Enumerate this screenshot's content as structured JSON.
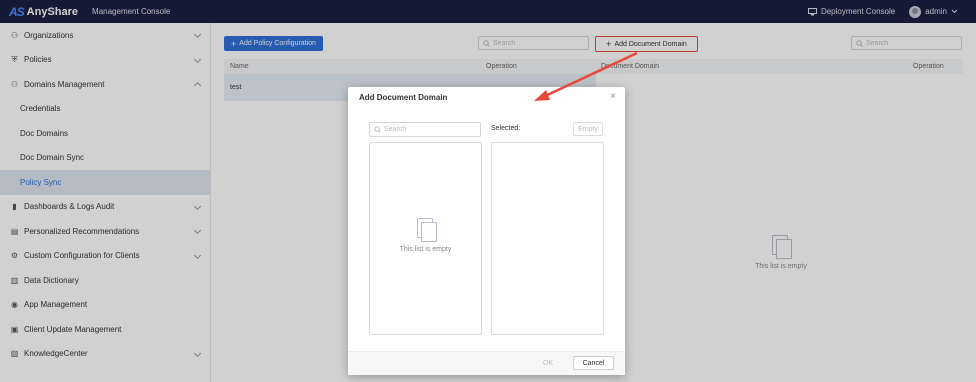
{
  "topbar": {
    "logo_mark": "AS",
    "logo_text": "AnyShare",
    "console_title": "Management Console",
    "deployment_console": "Deployment Console",
    "user": "admin"
  },
  "sidebar": {
    "items": [
      {
        "label": "Organizations",
        "icon": "org-icon",
        "expand": "down"
      },
      {
        "label": "Policies",
        "icon": "shield-icon",
        "expand": "down"
      },
      {
        "label": "Domains Management",
        "icon": "domain-icon",
        "expand": "up"
      },
      {
        "label": "Credentials",
        "sub": true
      },
      {
        "label": "Doc Domains",
        "sub": true
      },
      {
        "label": "Doc Domain Sync",
        "sub": true
      },
      {
        "label": "Policy Sync",
        "sub": true,
        "active": true
      },
      {
        "label": "Dashboards & Logs Audit",
        "icon": "bar-chart-icon",
        "expand": "down"
      },
      {
        "label": "Personalized Recommendations",
        "icon": "recommend-icon",
        "expand": "down"
      },
      {
        "label": "Custom Configuration for Clients",
        "icon": "gear-icon",
        "expand": "down"
      },
      {
        "label": "Data Dictionary",
        "icon": "book-icon"
      },
      {
        "label": "App Management",
        "icon": "app-icon"
      },
      {
        "label": "Client Update Management",
        "icon": "update-icon"
      },
      {
        "label": "KnowledgeCenter",
        "icon": "knowledge-icon",
        "expand": "down"
      }
    ]
  },
  "main": {
    "add_policy_button": "Add Policy Configuration",
    "left_search_placeholder": "Search",
    "add_domain_button": "Add Document Domain",
    "right_search_placeholder": "Search",
    "left_table": {
      "col_name": "Name",
      "col_operation": "Operation",
      "rows": [
        "test"
      ]
    },
    "right_table": {
      "col_domain": "Document Domain",
      "col_operation": "Operation"
    },
    "right_empty": "This list is empty"
  },
  "dialog": {
    "title": "Add Document Domain",
    "search_placeholder": "Search",
    "selected_label": "Selected:",
    "empty_button": "Empty",
    "left_empty": "This list is empty",
    "ok_button": "OK",
    "cancel_button": "Cancel"
  },
  "colors": {
    "topbar": "#1a2141",
    "primary": "#2f6fd6",
    "highlight_border": "#e8483a"
  }
}
